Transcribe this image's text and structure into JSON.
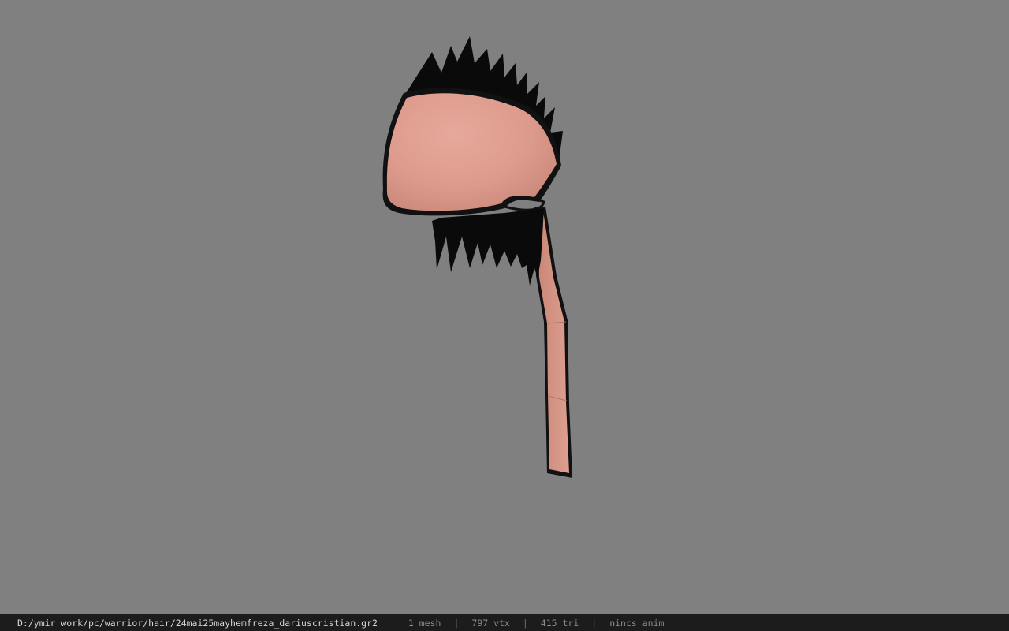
{
  "viewport": {
    "background_color": "#808080",
    "model": {
      "skin_color": "#dc9a8c",
      "outline_color": "#111111",
      "hair_color": "#0a0a0a"
    }
  },
  "status_bar": {
    "file_path": "D:/ymir work/pc/warrior/hair/24mai25mayhemfreza_dariuscristian.gr2",
    "separator": "|",
    "mesh_count": "1 mesh",
    "vertex_count": "797 vtx",
    "triangle_count": "415 tri",
    "animation": "nincs anim"
  }
}
